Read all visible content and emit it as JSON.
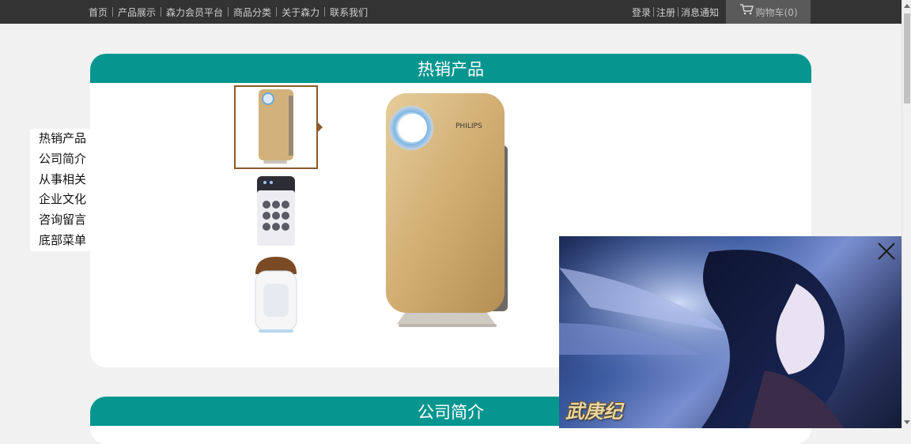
{
  "topnav": {
    "items": [
      "首页",
      "产品展示",
      "森力会员平台",
      "商品分类",
      "关于森力",
      "联系我们"
    ]
  },
  "account": {
    "login": "登录",
    "register": "注册",
    "notifications": "消息通知"
  },
  "cart": {
    "label": "购物车(0)",
    "icon": "cart-icon"
  },
  "sidemenu": {
    "items": [
      "热销产品",
      "公司简介",
      "从事相关",
      "企业文化",
      "咨询留言",
      "底部菜单"
    ]
  },
  "sections": {
    "hot": {
      "title": "热销产品",
      "main_brand": "PHILIPS"
    },
    "about": {
      "title": "公司简介"
    }
  },
  "ad": {
    "logo": "武庚纪",
    "close_icon": "close-icon"
  },
  "colors": {
    "topbar": "#333333",
    "accent": "#06968f",
    "background": "#f1f1f1"
  }
}
